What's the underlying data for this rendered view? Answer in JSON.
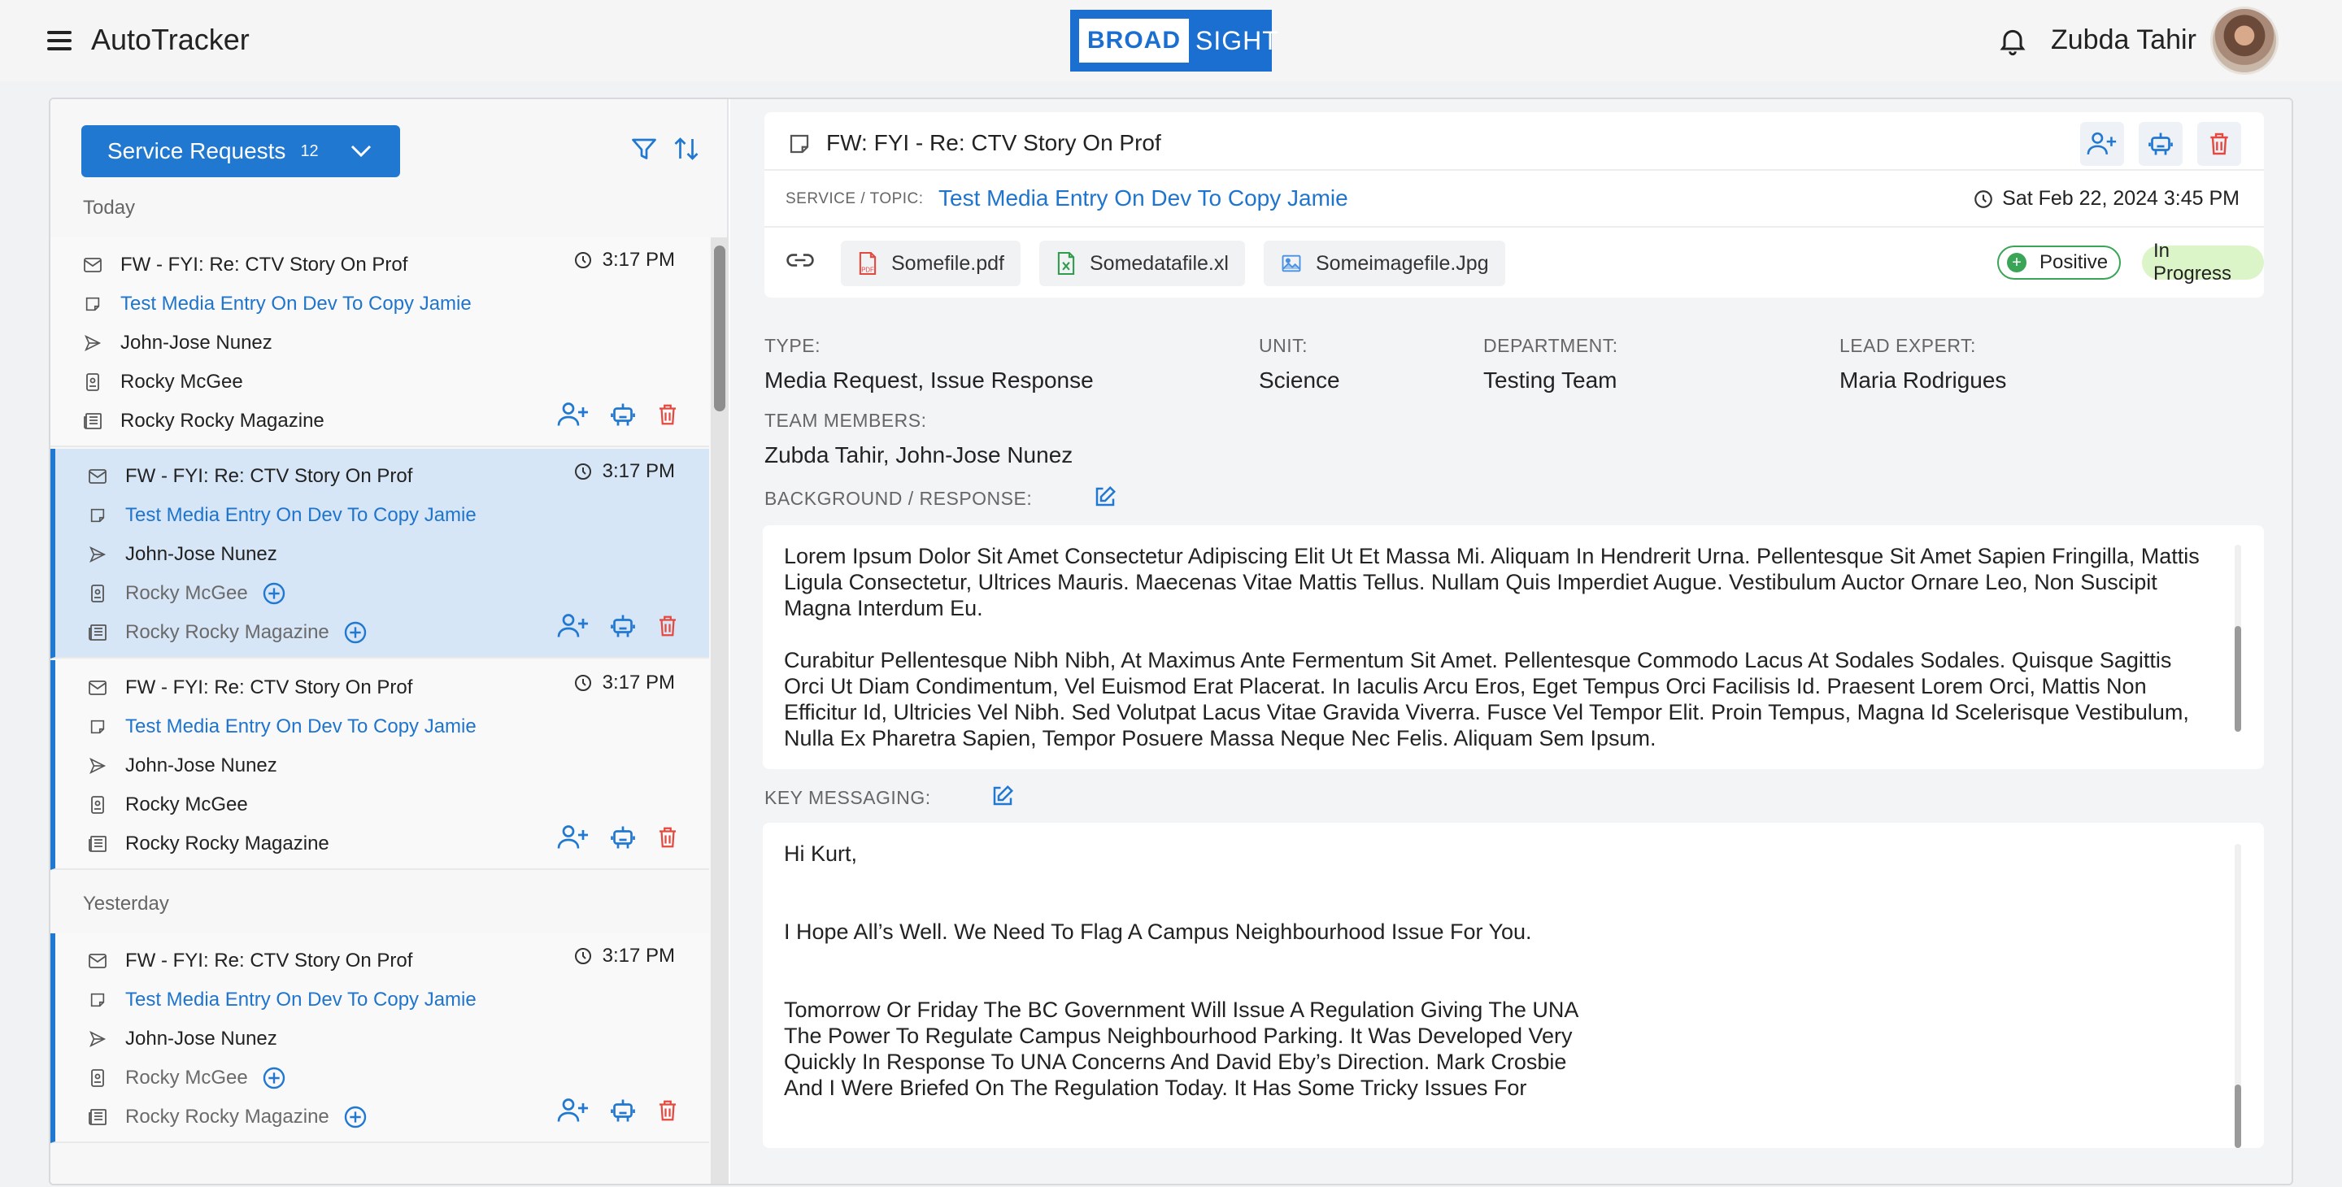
{
  "app": {
    "title": "AutoTracker",
    "logo_left": "BROAD",
    "logo_right": "SIGHT",
    "user_name": "Zubda Tahir"
  },
  "sidebar": {
    "dropdown_label": "Service Requests",
    "dropdown_count": "12",
    "groups": [
      "Today",
      "Yesterday"
    ],
    "cards": [
      {
        "subject": "FW - FYI: Re: CTV Story On Prof",
        "time": "3:17 PM",
        "topic": "Test Media Entry On Dev To Copy Jamie",
        "sender": "John-Jose Nunez",
        "contact": "Rocky McGee",
        "outlet": "Rocky Rocky Magazine"
      },
      {
        "subject": "FW - FYI: Re: CTV Story On Prof",
        "time": "3:17 PM",
        "topic": "Test Media Entry On Dev To Copy Jamie",
        "sender": "John-Jose Nunez",
        "contact": "Rocky McGee",
        "outlet": "Rocky Rocky Magazine"
      },
      {
        "subject": "FW - FYI: Re: CTV Story On Prof",
        "time": "3:17 PM",
        "topic": "Test Media Entry On Dev To Copy Jamie",
        "sender": "John-Jose Nunez",
        "contact": "Rocky McGee",
        "outlet": "Rocky Rocky Magazine"
      },
      {
        "subject": "FW - FYI: Re: CTV Story On Prof",
        "time": "3:17 PM",
        "topic": "Test Media Entry On Dev To Copy Jamie",
        "sender": "John-Jose Nunez",
        "contact": "Rocky McGee",
        "outlet": "Rocky Rocky Magazine"
      }
    ]
  },
  "detail": {
    "title": "FW: FYI - Re: CTV Story On Prof",
    "service_label": "SERVICE / TOPIC:",
    "service_value": "Test Media Entry On Dev To Copy Jamie",
    "date": "Sat Feb 22, 2024 3:45 PM",
    "attachments": [
      "Somefile.pdf",
      "Somedatafile.xl",
      "Someimagefile.Jpg"
    ],
    "sentiment": "Positive",
    "status": "In Progress",
    "type_label": "TYPE:",
    "type_value": "Media  Request, Issue Response",
    "unit_label": "UNIT:",
    "unit_value": "Science",
    "dept_label": "DEPARTMENT:",
    "dept_value": "Testing Team",
    "lead_label": "LEAD EXPERT:",
    "lead_value": "Maria Rodrigues",
    "team_label": "TEAM MEMBERS:",
    "team_value": "Zubda Tahir, John-Jose Nunez",
    "background_label": "BACKGROUND / RESPONSE:",
    "background_text": "Lorem Ipsum Dolor Sit Amet Consectetur Adipiscing Elit Ut Et Massa Mi. Aliquam In Hendrerit Urna. Pellentesque Sit Amet Sapien Fringilla, Mattis Ligula Consectetur, Ultrices Mauris. Maecenas Vitae Mattis Tellus. Nullam Quis Imperdiet Augue. Vestibulum Auctor Ornare Leo, Non Suscipit Magna Interdum Eu.\n\nCurabitur Pellentesque Nibh Nibh, At Maximus Ante Fermentum Sit Amet. Pellentesque Commodo Lacus At Sodales Sodales. Quisque Sagittis Orci Ut Diam Condimentum, Vel Euismod Erat Placerat. In Iaculis Arcu Eros, Eget Tempus Orci Facilisis Id. Praesent Lorem Orci, Mattis Non Efficitur Id, Ultricies Vel Nibh. Sed Volutpat Lacus Vitae Gravida Viverra. Fusce Vel Tempor Elit. Proin Tempus, Magna Id Scelerisque Vestibulum, Nulla Ex Pharetra Sapien, Tempor Posuere Massa Neque Nec Felis. Aliquam Sem Ipsum.",
    "key_label": "KEY MESSAGING:",
    "key_text": "Hi Kurt,\n\n\nI Hope All’s Well. We Need To Flag A Campus Neighbourhood Issue For You.\n\n\nTomorrow Or Friday The BC Government Will Issue A Regulation Giving The UNA\nThe Power To Regulate Campus Neighbourhood Parking. It Was Developed Very\nQuickly In Response To UNA Concerns And David Eby’s Direction. Mark Crosbie\nAnd I Were Briefed On The Regulation Today. It Has Some Tricky Issues For"
  },
  "colors": {
    "accent": "#2178d0",
    "danger": "#e5483e",
    "positive": "#3aa557",
    "progress_bg": "#dcf5c8",
    "selected_bg": "#d6e6f7"
  }
}
